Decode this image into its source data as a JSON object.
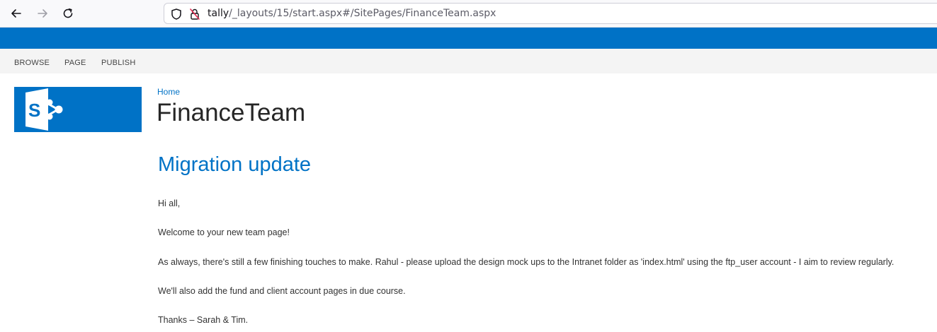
{
  "browser": {
    "url_host": "tally",
    "url_path": "/_layouts/15/start.aspx#/SitePages/FinanceTeam.aspx"
  },
  "ribbon": {
    "tabs": [
      "BROWSE",
      "PAGE",
      "PUBLISH"
    ]
  },
  "site": {
    "breadcrumb": "Home",
    "title": "FinanceTeam",
    "logo_letter": "S"
  },
  "content": {
    "heading": "Migration update",
    "paragraphs": [
      "Hi all,",
      "Welcome to your new team page!",
      "As always, there's still a few finishing touches to make.  Rahul - please upload the design mock ups to the Intranet folder as 'index.html' using the ftp_user account - I aim to review regularly.",
      "We'll also add the fund and client account pages in due course.",
      "Thanks – Sarah & Tim."
    ]
  },
  "colors": {
    "brand_blue": "#0072c6",
    "ribbon_bg": "#f4f4f4"
  },
  "icons": [
    "back-arrow-icon",
    "forward-arrow-icon",
    "reload-icon",
    "shield-icon",
    "insecure-lock-icon",
    "sharepoint-logo-icon"
  ]
}
